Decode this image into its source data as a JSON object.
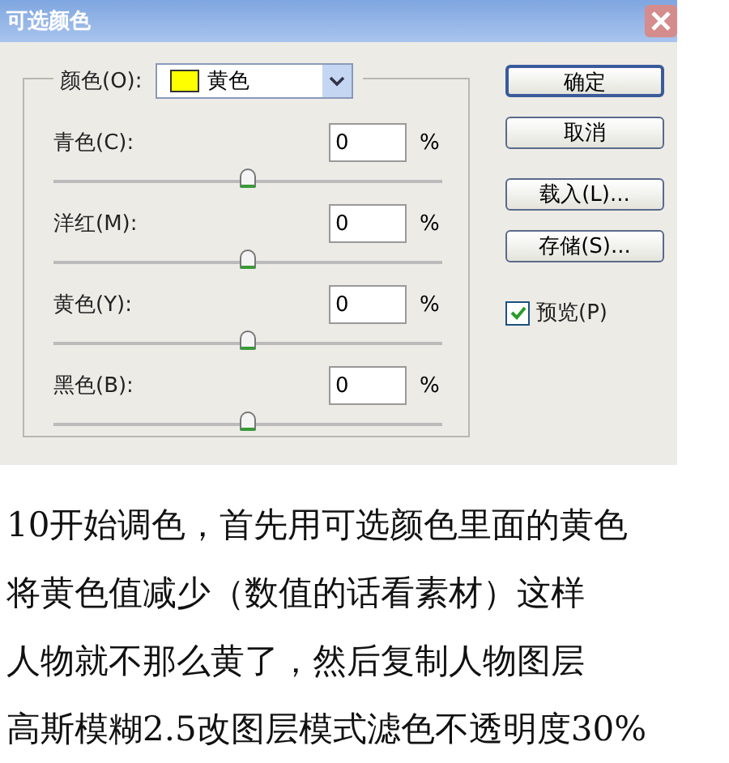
{
  "window": {
    "title": "可选颜色"
  },
  "colors": {
    "label": "颜色(O):",
    "value": "黄色",
    "color": "#ffff00"
  },
  "sliders": [
    {
      "label": "青色(C):",
      "value": "0",
      "unit": "%",
      "level": 0.5
    },
    {
      "label": "洋红(M):",
      "value": "0",
      "unit": "%",
      "level": 0.5
    },
    {
      "label": "黄色(Y):",
      "value": "0",
      "unit": "%",
      "level": 0.5
    },
    {
      "label": "黑色(B):",
      "value": "0",
      "unit": "%",
      "level": 0.5
    }
  ],
  "buttons": [
    {
      "label": "确定",
      "default": true
    },
    {
      "label": "取消",
      "default": false
    },
    {
      "label": "载入(L)...",
      "default": false
    },
    {
      "label": "存储(S)...",
      "default": false
    }
  ],
  "preview": {
    "label": "预览(P)",
    "checked": true
  },
  "article": {
    "lines": [
      "10开始调色，首先用可选颜色里面的黄色",
      "将黄色值减少（数值的话看素材）这样",
      "人物就不那么黄了，然后复制人物图层",
      "高斯模糊2.5改图层模式滤色不透明度30%"
    ]
  }
}
